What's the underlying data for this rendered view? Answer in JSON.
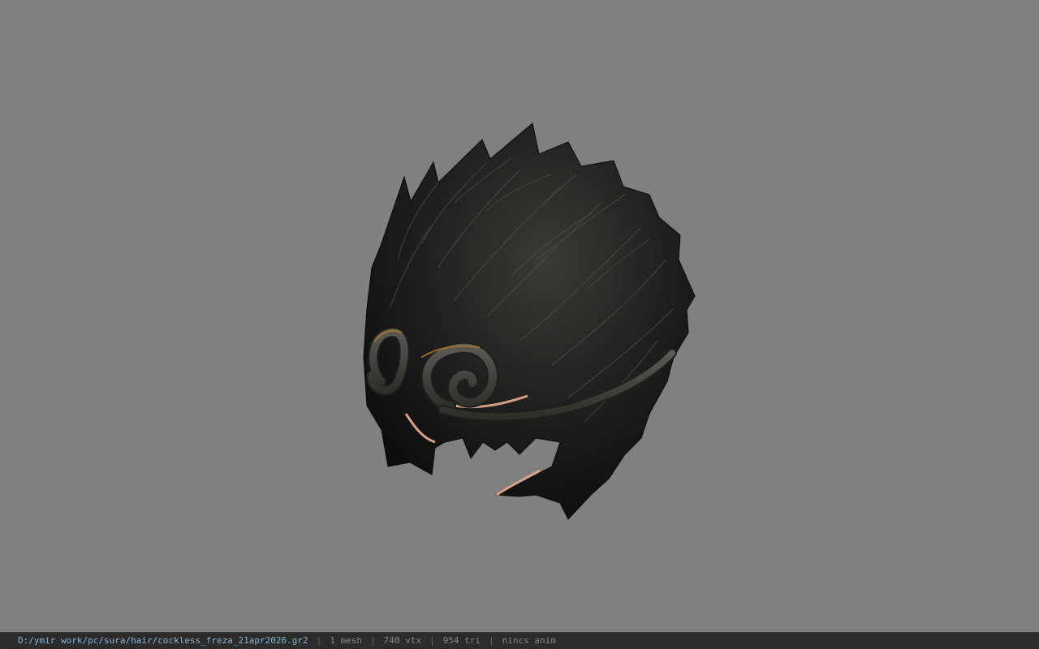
{
  "viewport": {
    "model": "hair-mesh",
    "background_color": "#808080"
  },
  "status_bar": {
    "file_path": "D:/ymir work/pc/sura/hair/cockless_freza_21apr2026.gr2",
    "separator": "|",
    "mesh_count": "1 mesh",
    "vertex_count": "740 vtx",
    "triangle_count": "954 tri",
    "animation": "nincs anim",
    "colors": {
      "background": "#2b2b2b",
      "path_text": "#8fb4cf",
      "info_text": "#8a8a8a"
    }
  }
}
